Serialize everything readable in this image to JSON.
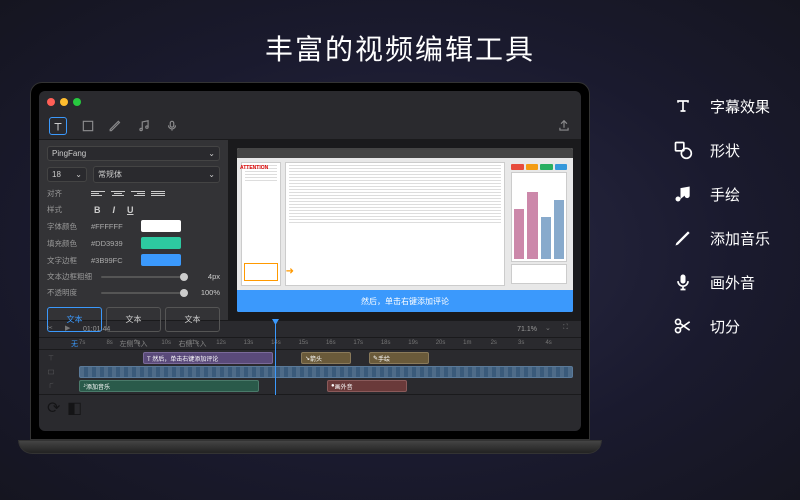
{
  "page_title": "丰富的视频编辑工具",
  "features": [
    {
      "icon": "text",
      "label": "字幕效果"
    },
    {
      "icon": "shape",
      "label": "形状"
    },
    {
      "icon": "draw",
      "label": "手绘"
    },
    {
      "icon": "music",
      "label": "添加音乐"
    },
    {
      "icon": "mic",
      "label": "画外音"
    },
    {
      "icon": "cut",
      "label": "切分"
    }
  ],
  "app": {
    "tools_active": "text",
    "panel": {
      "font_family": "PingFang",
      "font_size": "18",
      "font_weight": "常规体",
      "align_label": "对齐",
      "style_label": "样式",
      "font_color_label": "字体颜色",
      "font_color_hex": "#FFFFFF",
      "font_color": "#FFFFFF",
      "fill_color_label": "填充颜色",
      "fill_color_hex": "#DD3939",
      "fill_color": "#2DC9A0",
      "border_label": "文字边框",
      "border_hex": "#3B99FC",
      "border_color": "#3B99FC",
      "stroke_label": "文本边框粗细",
      "stroke_value": "4px",
      "opacity_label": "不透明度",
      "opacity_value": "100%",
      "anim": [
        {
          "label": "文本",
          "sub": "无",
          "active": true
        },
        {
          "label": "文本",
          "sub": "左侧飞入",
          "active": false
        },
        {
          "label": "文本",
          "sub": "右侧飞入",
          "active": false
        }
      ]
    },
    "preview": {
      "attention": "ATTENTION",
      "caption": "然后，单击右键添加评论"
    },
    "timeline": {
      "timecode": "01:01:44",
      "zoom": "71.1%",
      "ruler": [
        "7s",
        "8s",
        "9s",
        "10s",
        "11s",
        "12s",
        "13s",
        "14s",
        "15s",
        "16s",
        "17s",
        "18s",
        "19s",
        "20s",
        "1m",
        "2s",
        "3s",
        "4s"
      ],
      "clips": {
        "text1": "T 然后，单击右键添加评论",
        "annot1": "箭头",
        "annot2": "手绘",
        "audio": "添加音乐",
        "voice": "画外音"
      }
    }
  }
}
